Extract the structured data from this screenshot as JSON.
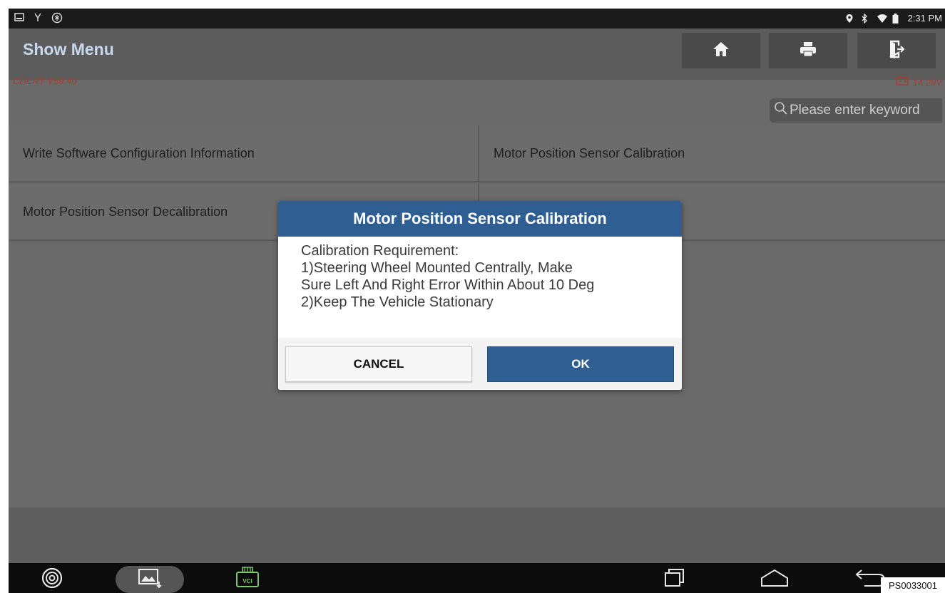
{
  "status_bar": {
    "time": "2:31 PM"
  },
  "header": {
    "title": "Show Menu",
    "version": "CHERY V59.40",
    "voltage": "14.29V"
  },
  "search": {
    "placeholder": "Please enter keyword"
  },
  "menu": {
    "items": [
      {
        "label": "Write Software Configuration Information"
      },
      {
        "label": "Motor Position Sensor Calibration"
      },
      {
        "label": "Motor Position Sensor Decalibration"
      }
    ]
  },
  "dialog": {
    "title": "Motor Position Sensor Calibration",
    "lines": [
      "Calibration Requirement:",
      "1)Steering Wheel Mounted Centrally, Make",
      "Sure Left And Right Error Within About 10 Deg",
      "2)Keep The Vehicle Stationary"
    ],
    "cancel_label": "CANCEL",
    "ok_label": "OK"
  },
  "navbar": {
    "vci_label": "VCI"
  },
  "image_code": "PS0033001",
  "colors": {
    "dialog_header": "#2f5f92",
    "ok_button": "#2f5f92",
    "version_text": "#a83a2a",
    "title_text": "#c8d8ee"
  },
  "icons": {
    "home": "home-icon",
    "print": "print-icon",
    "exit": "exit-icon",
    "battery": "battery-icon",
    "search": "search-icon",
    "browser": "browser-icon",
    "gallery": "gallery-icon",
    "vci": "vci-icon",
    "recent": "recent-apps-icon",
    "home_nav": "home-nav-icon",
    "back": "back-icon"
  }
}
